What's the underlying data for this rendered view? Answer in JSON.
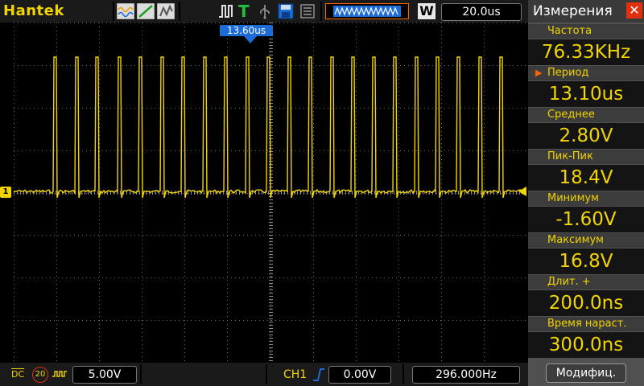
{
  "colors": {
    "trace": "#f2d400",
    "panel_label_bg": "#3c3c3c",
    "panel_value_bg": "#141414",
    "cursor_blue": "#1d6bd6",
    "close_red": "#e03010"
  },
  "topbar": {
    "brand": "Hantek",
    "timebase": "20.0us",
    "mode_letter": "W",
    "trigger_letter": "T"
  },
  "trigger_pos_label": "13.60us",
  "channel_marker": "1",
  "bottombar": {
    "coupling": "DC",
    "bw_limit": "20",
    "volts_div": "5.00V",
    "channel": "CH1",
    "trigger_level": "0.00V",
    "frequency": "296.000Hz"
  },
  "panel": {
    "title": "Измерения",
    "close_icon": "close-icon",
    "items": [
      {
        "label": "Частота",
        "value": "76.33KHz"
      },
      {
        "label": "Период",
        "value": "13.10us"
      },
      {
        "label": "Среднее",
        "value": "2.80V"
      },
      {
        "label": "Пик-Пик",
        "value": "18.4V"
      },
      {
        "label": "Минимум",
        "value": "-1.60V"
      },
      {
        "label": "Максимум",
        "value": "16.8V"
      },
      {
        "label": "Длит.  +",
        "value": "200.0ns"
      },
      {
        "label": "Время  нараст.",
        "value": "300.0ns"
      }
    ],
    "modify_button": "Модифиц."
  }
}
